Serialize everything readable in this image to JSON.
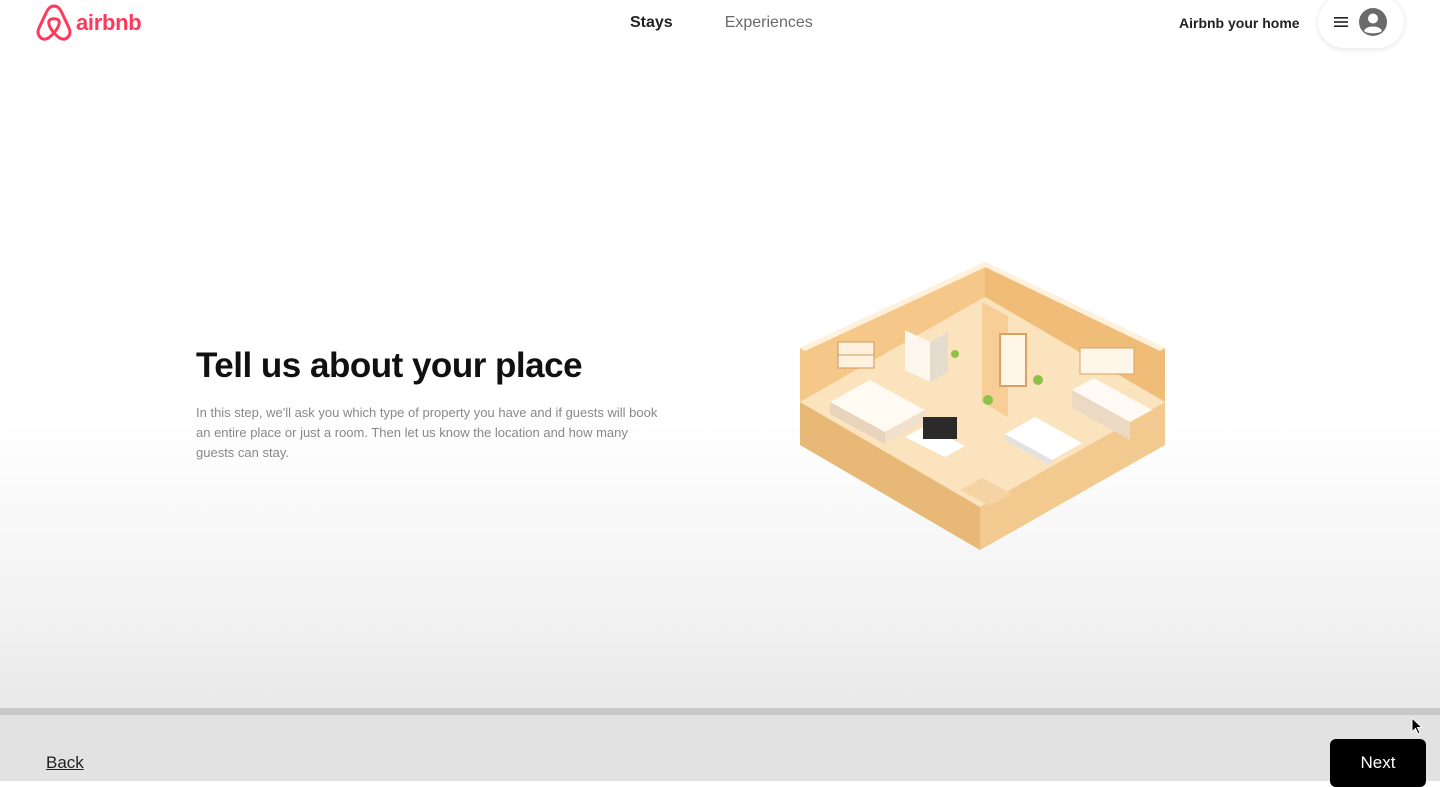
{
  "header": {
    "logo_text": "airbnb",
    "nav": {
      "stays": "Stays",
      "experiences": "Experiences"
    },
    "host_link": "Airbnb your home",
    "icons": {
      "logo": "airbnb-belo-icon",
      "menu": "hamburger-menu-icon",
      "avatar": "user-avatar-icon"
    }
  },
  "main": {
    "title": "Tell us about your place",
    "description": "In this step, we'll ask you which type of property you have and if guests will book an entire place or just a room. Then let us know the location and how many guests can stay.",
    "illustration": "isometric-apartment-illustration"
  },
  "footer": {
    "back": "Back",
    "next": "Next"
  },
  "colors": {
    "brand": "#ff385c",
    "primary_button": "#000000",
    "text": "#222222",
    "muted_text": "#888888"
  }
}
